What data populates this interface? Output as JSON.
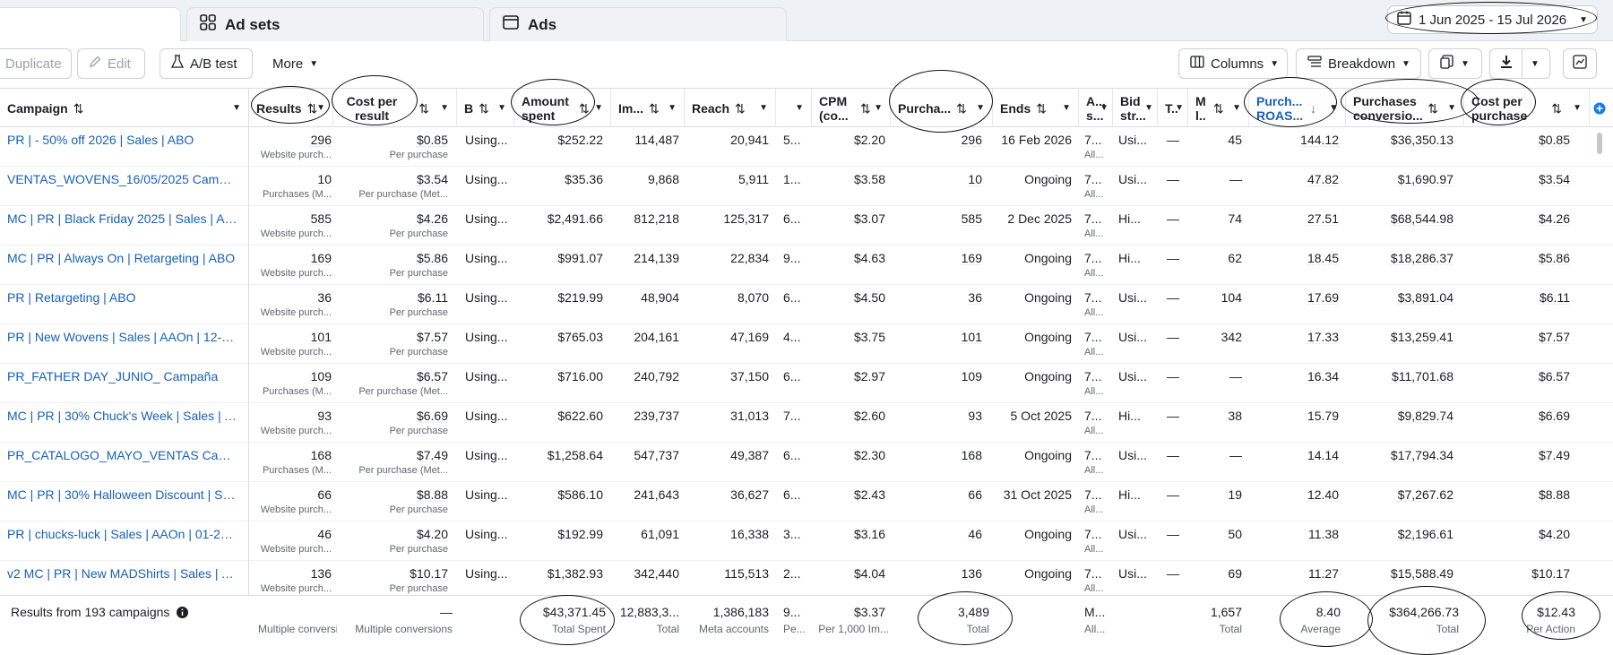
{
  "tabs": [
    {
      "label": "",
      "icon": "campaigns-icon"
    },
    {
      "label": "Ad sets",
      "icon": "grid-icon"
    },
    {
      "label": "Ads",
      "icon": "ad-card-icon"
    }
  ],
  "date_range": "1 Jun 2025 - 15 Jul 2026",
  "toolbar": {
    "duplicate": "Duplicate",
    "edit": "Edit",
    "ab_test": "A/B test",
    "more": "More",
    "columns": "Columns",
    "breakdown": "Breakdown"
  },
  "headers": {
    "campaign": "Campaign",
    "results": "Results",
    "cost_per_result": "Cost per result",
    "bid": "B",
    "amount_spent": "Amount spent",
    "impressions": "Im...",
    "reach": "Reach",
    "cpm": "CPM (co...",
    "purchases": "Purcha...",
    "ends": "Ends",
    "attribution": "A... s...",
    "bid_strategy": "Bid str...",
    "t_col": "T..",
    "m_col": "M l..",
    "roas": "Purch... ROAS...",
    "conversion_value": "Purchases conversio...",
    "cost_per_purchase": "Cost per purchase"
  },
  "rows": [
    {
      "name": "PR | - 50% off 2026 | Sales | ABO",
      "results": "296",
      "results_sub": "Website purch...",
      "cpr": "$0.85",
      "cpr_sub": "Per purchase",
      "bid": "Using...",
      "spent": "$252.22",
      "impr": "114,487",
      "reach": "20,941",
      "freq": "5...",
      "cpm": "$2.20",
      "purch": "296",
      "ends": "16 Feb 2026",
      "attr": "7...",
      "attr_sub": "All...",
      "bidstr": "Usi...",
      "t": "—",
      "m": "45",
      "roas": "144.12",
      "value": "$36,350.13",
      "cpp": "$0.85"
    },
    {
      "name": "VENTAS_WOVENS_16/05/2025 Campa...",
      "results": "10",
      "results_sub": "Purchases (M...",
      "cpr": "$3.54",
      "cpr_sub": "Per purchase (Met...",
      "bid": "Using...",
      "spent": "$35.36",
      "impr": "9,868",
      "reach": "5,911",
      "freq": "1...",
      "cpm": "$3.58",
      "purch": "10",
      "ends": "Ongoing",
      "attr": "7...",
      "attr_sub": "All...",
      "bidstr": "Usi...",
      "t": "—",
      "m": "—",
      "roas": "47.82",
      "value": "$1,690.97",
      "cpp": "$3.54"
    },
    {
      "name": "MC | PR | Black Friday 2025 | Sales | ABO",
      "results": "585",
      "results_sub": "Website purch...",
      "cpr": "$4.26",
      "cpr_sub": "Per purchase",
      "bid": "Using...",
      "spent": "$2,491.66",
      "impr": "812,218",
      "reach": "125,317",
      "freq": "6...",
      "cpm": "$3.07",
      "purch": "585",
      "ends": "2 Dec 2025",
      "attr": "7...",
      "attr_sub": "All...",
      "bidstr": "Hi...",
      "t": "—",
      "m": "74",
      "roas": "27.51",
      "value": "$68,544.98",
      "cpp": "$4.26"
    },
    {
      "name": "MC | PR | Always On | Retargeting | ABO",
      "results": "169",
      "results_sub": "Website purch...",
      "cpr": "$5.86",
      "cpr_sub": "Per purchase",
      "bid": "Using...",
      "spent": "$991.07",
      "impr": "214,139",
      "reach": "22,834",
      "freq": "9...",
      "cpm": "$4.63",
      "purch": "169",
      "ends": "Ongoing",
      "attr": "7...",
      "attr_sub": "All...",
      "bidstr": "Hi...",
      "t": "—",
      "m": "62",
      "roas": "18.45",
      "value": "$18,286.37",
      "cpp": "$5.86"
    },
    {
      "name": "PR | Retargeting | ABO",
      "results": "36",
      "results_sub": "Website purch...",
      "cpr": "$6.11",
      "cpr_sub": "Per purchase",
      "bid": "Using...",
      "spent": "$219.99",
      "impr": "48,904",
      "reach": "8,070",
      "freq": "6...",
      "cpm": "$4.50",
      "purch": "36",
      "ends": "Ongoing",
      "attr": "7...",
      "attr_sub": "All...",
      "bidstr": "Usi...",
      "t": "—",
      "m": "104",
      "roas": "17.69",
      "value": "$3,891.04",
      "cpp": "$6.11"
    },
    {
      "name": "PR | New Wovens | Sales | AAOn | 12-11-...",
      "results": "101",
      "results_sub": "Website purch...",
      "cpr": "$7.57",
      "cpr_sub": "Per purchase",
      "bid": "Using...",
      "spent": "$765.03",
      "impr": "204,161",
      "reach": "47,169",
      "freq": "4...",
      "cpm": "$3.75",
      "purch": "101",
      "ends": "Ongoing",
      "attr": "7...",
      "attr_sub": "All...",
      "bidstr": "Usi...",
      "t": "—",
      "m": "342",
      "roas": "17.33",
      "value": "$13,259.41",
      "cpp": "$7.57"
    },
    {
      "name": "PR_FATHER DAY_JUNIO_ Campaña",
      "results": "109",
      "results_sub": "Purchases (M...",
      "cpr": "$6.57",
      "cpr_sub": "Per purchase (Met...",
      "bid": "Using...",
      "spent": "$716.00",
      "impr": "240,792",
      "reach": "37,150",
      "freq": "6...",
      "cpm": "$2.97",
      "purch": "109",
      "ends": "Ongoing",
      "attr": "7...",
      "attr_sub": "All...",
      "bidstr": "Usi...",
      "t": "—",
      "m": "—",
      "roas": "16.34",
      "value": "$11,701.68",
      "cpp": "$6.57"
    },
    {
      "name": "MC | PR | 30% Chuck's Week | Sales | Ad...",
      "results": "93",
      "results_sub": "Website purch...",
      "cpr": "$6.69",
      "cpr_sub": "Per purchase",
      "bid": "Using...",
      "spent": "$622.60",
      "impr": "239,737",
      "reach": "31,013",
      "freq": "7...",
      "cpm": "$2.60",
      "purch": "93",
      "ends": "5 Oct 2025",
      "attr": "7...",
      "attr_sub": "All...",
      "bidstr": "Hi...",
      "t": "—",
      "m": "38",
      "roas": "15.79",
      "value": "$9,829.74",
      "cpp": "$6.69"
    },
    {
      "name": "PR_CATALOGO_MAYO_VENTAS Camp...",
      "results": "168",
      "results_sub": "Purchases (M...",
      "cpr": "$7.49",
      "cpr_sub": "Per purchase (Met...",
      "bid": "Using...",
      "spent": "$1,258.64",
      "impr": "547,737",
      "reach": "49,387",
      "freq": "6...",
      "cpm": "$2.30",
      "purch": "168",
      "ends": "Ongoing",
      "attr": "7...",
      "attr_sub": "All...",
      "bidstr": "Usi...",
      "t": "—",
      "m": "—",
      "roas": "14.14",
      "value": "$17,794.34",
      "cpp": "$7.49"
    },
    {
      "name": "MC | PR | 30% Halloween Discount | Sal...",
      "results": "66",
      "results_sub": "Website purch...",
      "cpr": "$8.88",
      "cpr_sub": "Per purchase",
      "bid": "Using...",
      "spent": "$586.10",
      "impr": "241,643",
      "reach": "36,627",
      "freq": "6...",
      "cpm": "$2.43",
      "purch": "66",
      "ends": "31 Oct 2025",
      "attr": "7...",
      "attr_sub": "All...",
      "bidstr": "Hi...",
      "t": "—",
      "m": "19",
      "roas": "12.40",
      "value": "$7,267.62",
      "cpp": "$8.88"
    },
    {
      "name": "PR | chucks-luck | Sales | AAOn | 01-27-...",
      "results": "46",
      "results_sub": "Website purch...",
      "cpr": "$4.20",
      "cpr_sub": "Per purchase",
      "bid": "Using...",
      "spent": "$192.99",
      "impr": "61,091",
      "reach": "16,338",
      "freq": "3...",
      "cpm": "$3.16",
      "purch": "46",
      "ends": "Ongoing",
      "attr": "7...",
      "attr_sub": "All...",
      "bidstr": "Usi...",
      "t": "—",
      "m": "50",
      "roas": "11.38",
      "value": "$2,196.61",
      "cpp": "$4.20"
    },
    {
      "name": "v2 MC | PR | New MADShirts | Sales | A...",
      "results": "136",
      "results_sub": "Website purch...",
      "cpr": "$10.17",
      "cpr_sub": "Per purchase",
      "bid": "Using...",
      "spent": "$1,382.93",
      "impr": "342,440",
      "reach": "115,513",
      "freq": "2...",
      "cpm": "$4.04",
      "purch": "136",
      "ends": "Ongoing",
      "attr": "7...",
      "attr_sub": "All...",
      "bidstr": "Usi...",
      "t": "—",
      "m": "69",
      "roas": "11.27",
      "value": "$15,588.49",
      "cpp": "$10.17"
    }
  ],
  "footer": {
    "label": "Results from 193 campaigns",
    "results_sub": "Multiple conversic",
    "cpr": "—",
    "cpr_sub": "Multiple conversions",
    "spent": "$43,371.45",
    "spent_sub": "Total Spent",
    "impr": "12,883,3...",
    "impr_sub": "Total",
    "reach": "1,386,183",
    "reach_sub": "Meta accounts",
    "freq": "9...",
    "freq_sub": "Pe...",
    "cpm": "$3.37",
    "cpm_sub": "Per 1,000 Im...",
    "purch": "3,489",
    "purch_sub": "Total",
    "attr": "M...",
    "attr_sub": "All...",
    "m": "1,657",
    "m_sub": "Total",
    "roas": "8.40",
    "roas_sub": "Average",
    "value": "$364,266.73",
    "value_sub": "Total",
    "cpp": "$12.43",
    "cpp_sub": "Per Action"
  },
  "colors": {
    "link": "#1660b8",
    "accent": "#1877f2"
  }
}
